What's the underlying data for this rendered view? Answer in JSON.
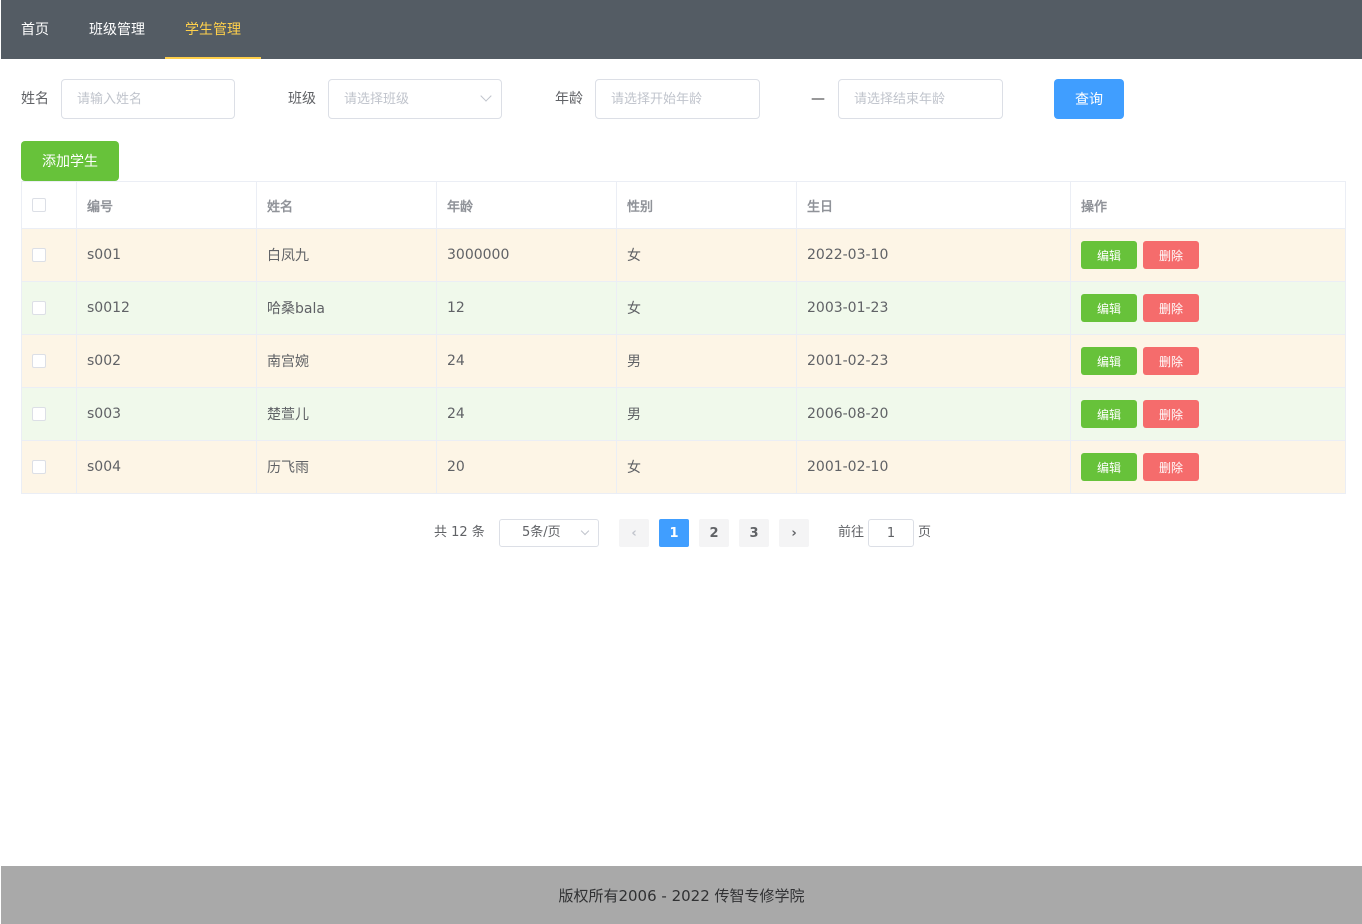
{
  "nav": {
    "items": [
      {
        "label": "首页"
      },
      {
        "label": "班级管理"
      },
      {
        "label": "学生管理"
      }
    ],
    "active_index": 2
  },
  "search": {
    "name_label": "姓名",
    "name_placeholder": "请输入姓名",
    "class_label": "班级",
    "class_placeholder": "请选择班级",
    "age_label": "年龄",
    "age_start_placeholder": "请选择开始年龄",
    "dash": "—",
    "age_end_placeholder": "请选择结束年龄",
    "query_label": "查询"
  },
  "toolbar": {
    "add_label": "添加学生"
  },
  "table": {
    "headers": [
      "编号",
      "姓名",
      "年龄",
      "性别",
      "生日",
      "操作"
    ],
    "rows": [
      {
        "id": "s001",
        "name": "白凤九",
        "age": "3000000",
        "gender": "女",
        "birthday": "2022-03-10",
        "status": "warn"
      },
      {
        "id": "s0012",
        "name": "哈桑bala",
        "age": "12",
        "gender": "女",
        "birthday": "2003-01-23",
        "status": "ok"
      },
      {
        "id": "s002",
        "name": "南宫婉",
        "age": "24",
        "gender": "男",
        "birthday": "2001-02-23",
        "status": "warn"
      },
      {
        "id": "s003",
        "name": "楚萱儿",
        "age": "24",
        "gender": "男",
        "birthday": "2006-08-20",
        "status": "ok"
      },
      {
        "id": "s004",
        "name": "历飞雨",
        "age": "20",
        "gender": "女",
        "birthday": "2001-02-10",
        "status": "warn"
      }
    ],
    "edit_label": "编辑",
    "delete_label": "删除"
  },
  "pagination": {
    "total_text": "共 12 条",
    "page_size": "5条/页",
    "pages": [
      "1",
      "2",
      "3"
    ],
    "current_page": "1",
    "goto_label": "前往",
    "goto_value": "1",
    "goto_suffix": "页"
  },
  "footer": {
    "text": "版权所有2006 - 2022 传智专修学院"
  },
  "colors": {
    "nav_bg": "#545c64",
    "nav_active": "#ffd04b",
    "primary": "#409eff",
    "success": "#67c23a",
    "danger": "#f56c6c",
    "row_warning": "#fdf5e6",
    "row_success": "#f0f9eb",
    "footer_bg": "#a9a9a9"
  }
}
